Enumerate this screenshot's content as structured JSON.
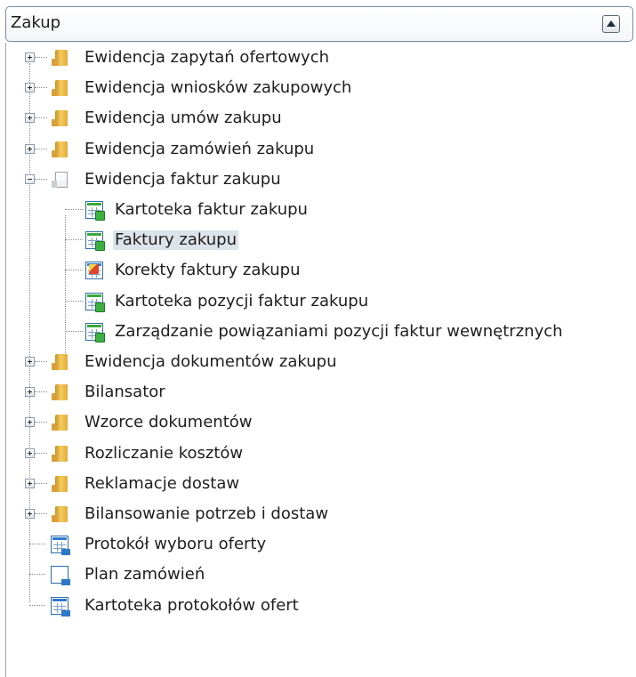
{
  "header": {
    "title": "Zakup"
  },
  "tree": [
    {
      "label": "Ewidencja zapytań ofertowych",
      "type": "folder",
      "expanded": false
    },
    {
      "label": "Ewidencja wniosków zakupowych",
      "type": "folder",
      "expanded": false
    },
    {
      "label": "Ewidencja umów zakupu",
      "type": "folder",
      "expanded": false
    },
    {
      "label": "Ewidencja zamówień zakupu",
      "type": "folder",
      "expanded": false
    },
    {
      "label": "Ewidencja faktur zakupu",
      "type": "folder",
      "expanded": true
    },
    {
      "label": "Kartoteka faktur zakupu",
      "type": "child",
      "icon": "green-document-icon"
    },
    {
      "label": "Faktury zakupu",
      "type": "child",
      "icon": "green-document-icon",
      "selected": true
    },
    {
      "label": "Korekty faktury zakupu",
      "type": "child",
      "icon": "correction-document-icon"
    },
    {
      "label": "Kartoteka pozycji faktur zakupu",
      "type": "child",
      "icon": "green-document-icon"
    },
    {
      "label": "Zarządzanie powiązaniami pozycji faktur wewnętrznych",
      "type": "child",
      "icon": "green-document-icon"
    },
    {
      "label": "Ewidencja dokumentów zakupu",
      "type": "folder",
      "expanded": false
    },
    {
      "label": "Bilansator",
      "type": "folder",
      "expanded": false
    },
    {
      "label": "Wzorce dokumentów",
      "type": "folder",
      "expanded": false
    },
    {
      "label": "Rozliczanie kosztów",
      "type": "folder",
      "expanded": false
    },
    {
      "label": "Reklamacje dostaw",
      "type": "folder",
      "expanded": false
    },
    {
      "label": "Bilansowanie potrzeb i dostaw",
      "type": "folder",
      "expanded": false
    },
    {
      "label": "Protokół wyboru oferty",
      "type": "item",
      "icon": "report-document-icon"
    },
    {
      "label": "Plan zamówień",
      "type": "item",
      "icon": "plan-grid-icon"
    },
    {
      "label": "Kartoteka protokołów ofert",
      "type": "item",
      "icon": "report-document-icon"
    }
  ]
}
